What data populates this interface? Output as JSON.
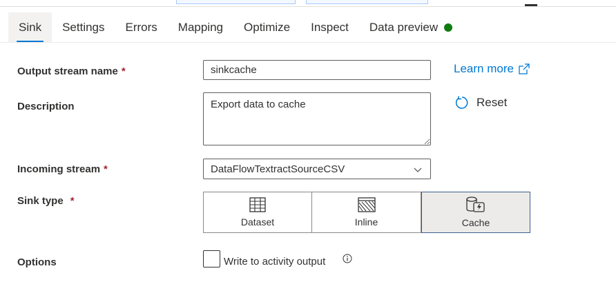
{
  "tabs": [
    {
      "label": "Sink",
      "active": true
    },
    {
      "label": "Settings"
    },
    {
      "label": "Errors"
    },
    {
      "label": "Mapping"
    },
    {
      "label": "Optimize"
    },
    {
      "label": "Inspect"
    },
    {
      "label": "Data preview",
      "status": "green-dot",
      "status_color": "#107c10"
    }
  ],
  "form": {
    "output_stream_name": {
      "label": "Output stream name",
      "required": "*",
      "value": "sinkcache"
    },
    "description": {
      "label": "Description",
      "value": "Export data to cache"
    },
    "incoming_stream": {
      "label": "Incoming stream",
      "required": "*",
      "value": "DataFlowTextractSourceCSV"
    },
    "sink_type": {
      "label": "Sink type",
      "required": "*",
      "options": [
        {
          "label": "Dataset",
          "icon": "table-icon"
        },
        {
          "label": "Inline",
          "icon": "hatched-table-icon"
        },
        {
          "label": "Cache",
          "icon": "cache-icon",
          "selected": true
        }
      ]
    },
    "options": {
      "label": "Options",
      "checkbox_label": "Write to activity output",
      "checked": false
    }
  },
  "actions": {
    "learn_more": "Learn more",
    "reset": "Reset"
  },
  "colors": {
    "accent": "#0078d4",
    "required": "#a4262c",
    "status_ok": "#107c10"
  }
}
